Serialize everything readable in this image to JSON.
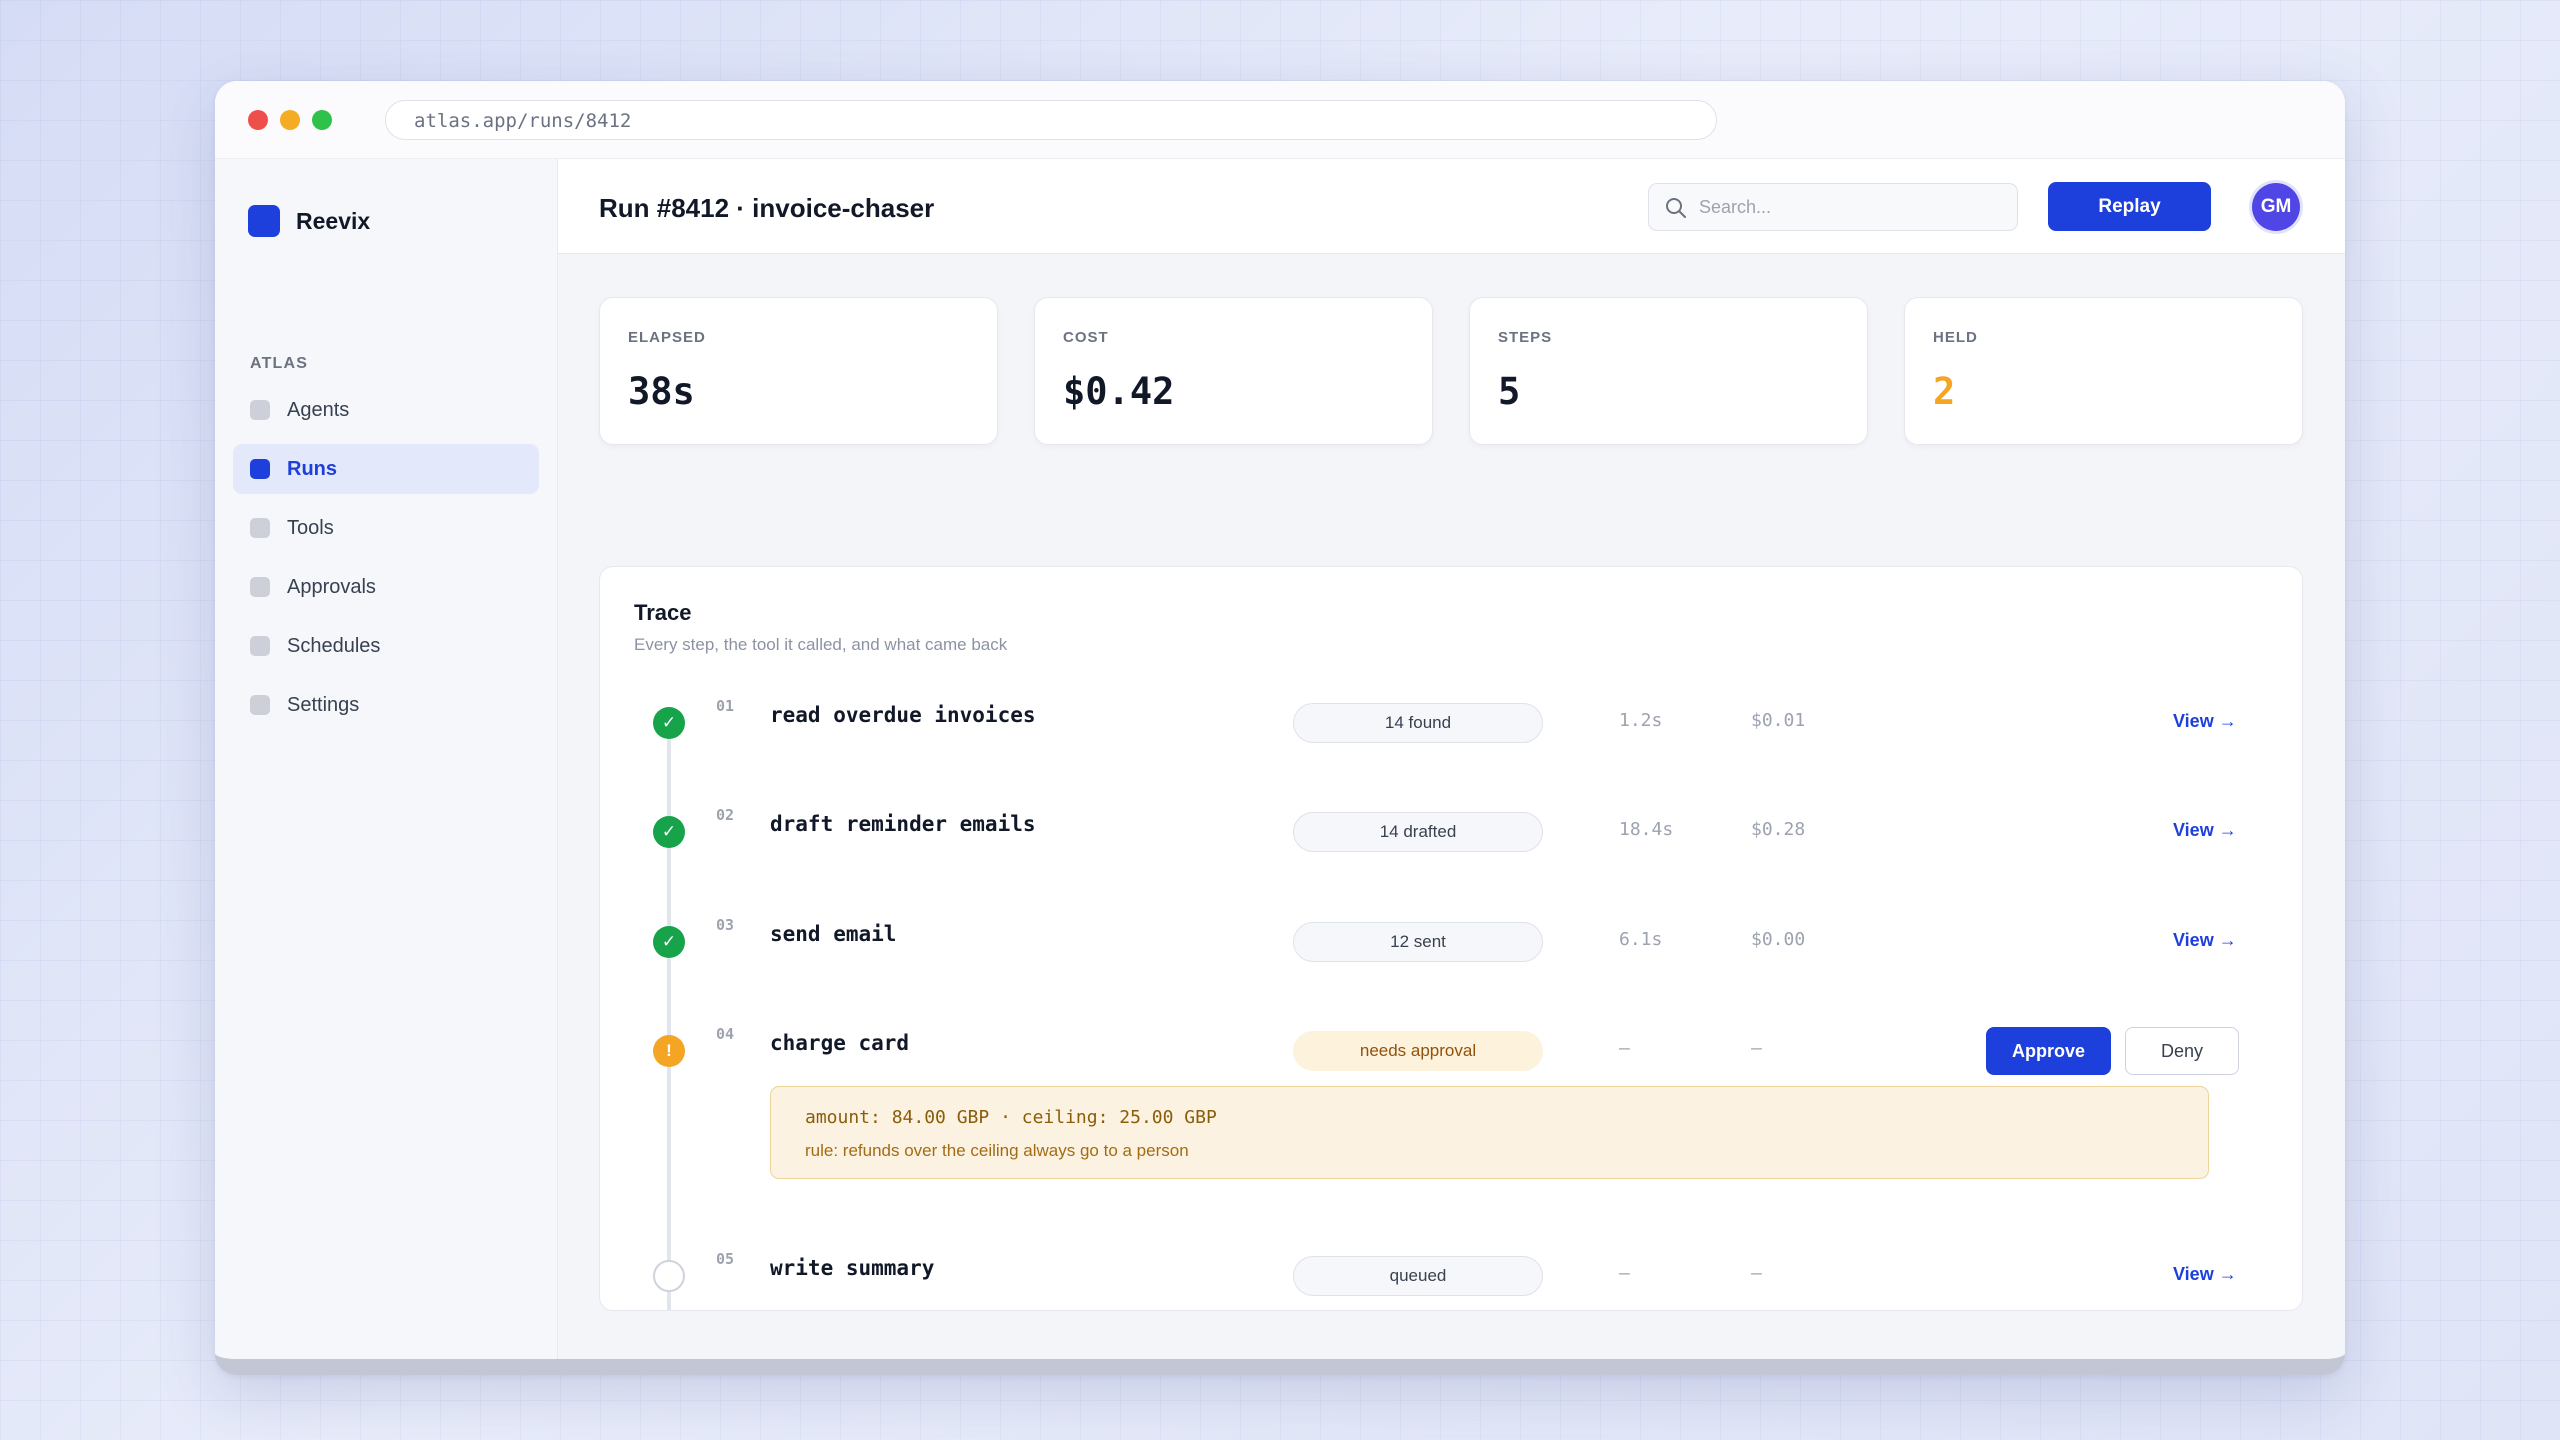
{
  "browser": {
    "url": "atlas.app/runs/8412"
  },
  "sidebar": {
    "brand": "Reevix",
    "section_label": "ATLAS",
    "items": [
      {
        "label": "Agents",
        "active": false
      },
      {
        "label": "Runs",
        "active": true
      },
      {
        "label": "Tools",
        "active": false
      },
      {
        "label": "Approvals",
        "active": false
      },
      {
        "label": "Schedules",
        "active": false
      },
      {
        "label": "Settings",
        "active": false
      }
    ]
  },
  "header": {
    "title": "Run #8412 · invoice-chaser",
    "search_placeholder": "Search...",
    "replay_label": "Replay",
    "avatar_initials": "GM"
  },
  "stats": [
    {
      "label": "ELAPSED",
      "value": "38s"
    },
    {
      "label": "COST",
      "value": "$0.42"
    },
    {
      "label": "STEPS",
      "value": "5"
    },
    {
      "label": "HELD",
      "value": "2",
      "color": "#f5a524"
    }
  ],
  "trace": {
    "title": "Trace",
    "subtitle": "Every step, the tool it called, and what came back",
    "steps": [
      {
        "num": "01",
        "name": "read overdue invoices",
        "badge": "14 found",
        "time": "1.2s",
        "cost": "$0.01",
        "view": "View →",
        "status": "done",
        "status_icon": "check-icon",
        "status_glyph": "✓"
      },
      {
        "num": "02",
        "name": "draft reminder emails",
        "badge": "14 drafted",
        "time": "18.4s",
        "cost": "$0.28",
        "view": "View →",
        "status": "done",
        "status_icon": "check-icon",
        "status_glyph": "✓"
      },
      {
        "num": "03",
        "name": "send email",
        "badge": "12 sent",
        "time": "6.1s",
        "cost": "$0.00",
        "view": "View →",
        "status": "done",
        "status_icon": "check-icon",
        "status_glyph": "✓"
      },
      {
        "num": "04",
        "name": "charge card",
        "badge": "needs approval",
        "time": "–",
        "cost": "–",
        "approve_label": "Approve",
        "deny_label": "Deny",
        "status": "warning",
        "status_icon": "warning-icon",
        "status_glyph": "!"
      },
      {
        "num": "05",
        "name": "write summary",
        "badge": "queued",
        "time": "–",
        "cost": "–",
        "view": "View →",
        "status": "pending",
        "status_icon": "pending-circle-icon",
        "status_glyph": ""
      }
    ],
    "approval": {
      "details": "amount: 84.00 GBP · ceiling: 25.00 GBP",
      "rule": "rule: refunds over the ceiling always go to a person"
    }
  },
  "colors": {
    "accent": "#1d3fdc",
    "success": "#16a34a",
    "warning": "#f5a524",
    "approval_bg": "#fcf2e1"
  }
}
